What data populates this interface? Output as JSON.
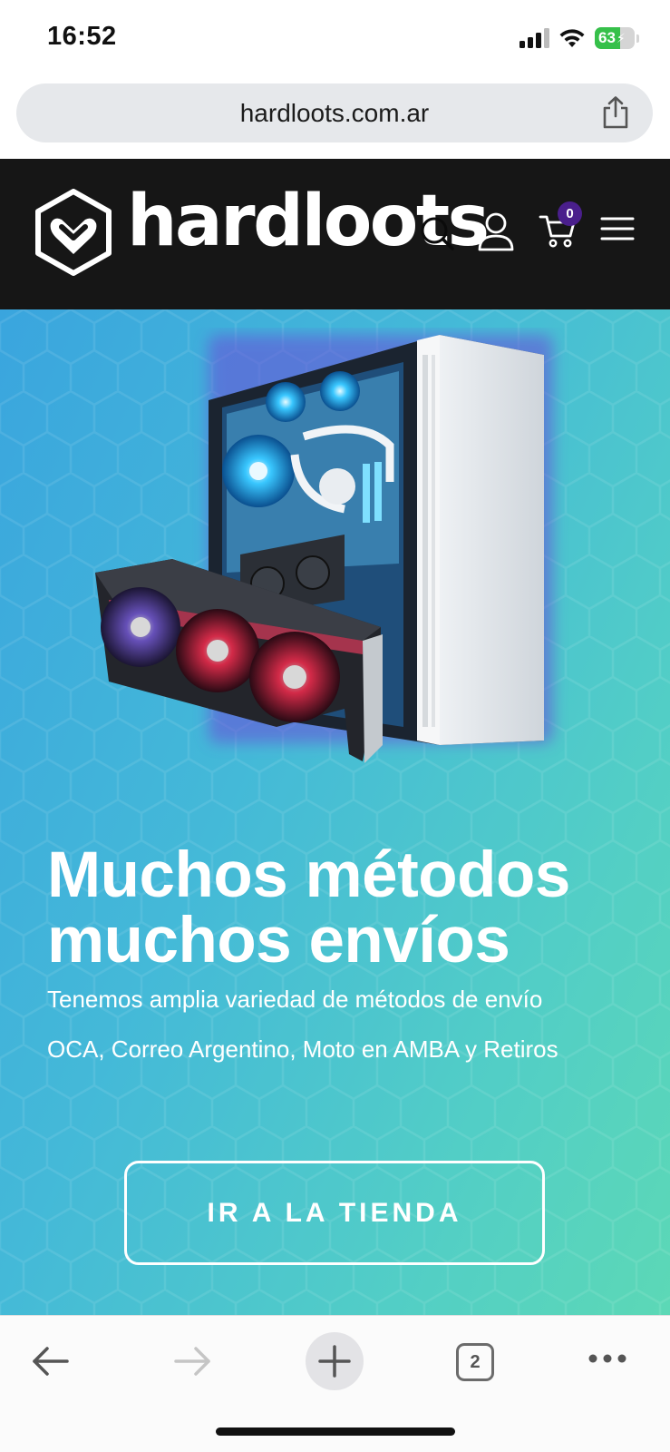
{
  "status_bar": {
    "time": "16:52",
    "battery_level": "63",
    "battery_fraction": 0.63,
    "signal_icon": "signal-bars-icon",
    "wifi_icon": "wifi-icon",
    "battery_color": "#36c04a"
  },
  "browser": {
    "url": "hardloots.com.ar",
    "share_icon": "share-icon",
    "tab_count": "2"
  },
  "site_header": {
    "logo_text": "hardloots",
    "cart_count": "0",
    "badge_color": "#4a1f8c",
    "background": "#161616",
    "icons": [
      "logo-mark-icon",
      "search-icon",
      "user-icon",
      "cart-icon",
      "menu-icon"
    ]
  },
  "hero": {
    "title": "Muchos métodos muchos envíos",
    "line_1": "Tenemos amplia variedad de métodos de envío",
    "line_2": "OCA, Correo Argentino, Moto en AMBA y Retiros",
    "button_label": "IR A LA TIENDA",
    "gradient": [
      "#3aa5de",
      "#5cd8b6"
    ]
  },
  "toolbar": {
    "icons": [
      "back-arrow-icon",
      "forward-arrow-icon",
      "plus-icon",
      "tabs-icon",
      "more-dots-icon"
    ]
  }
}
